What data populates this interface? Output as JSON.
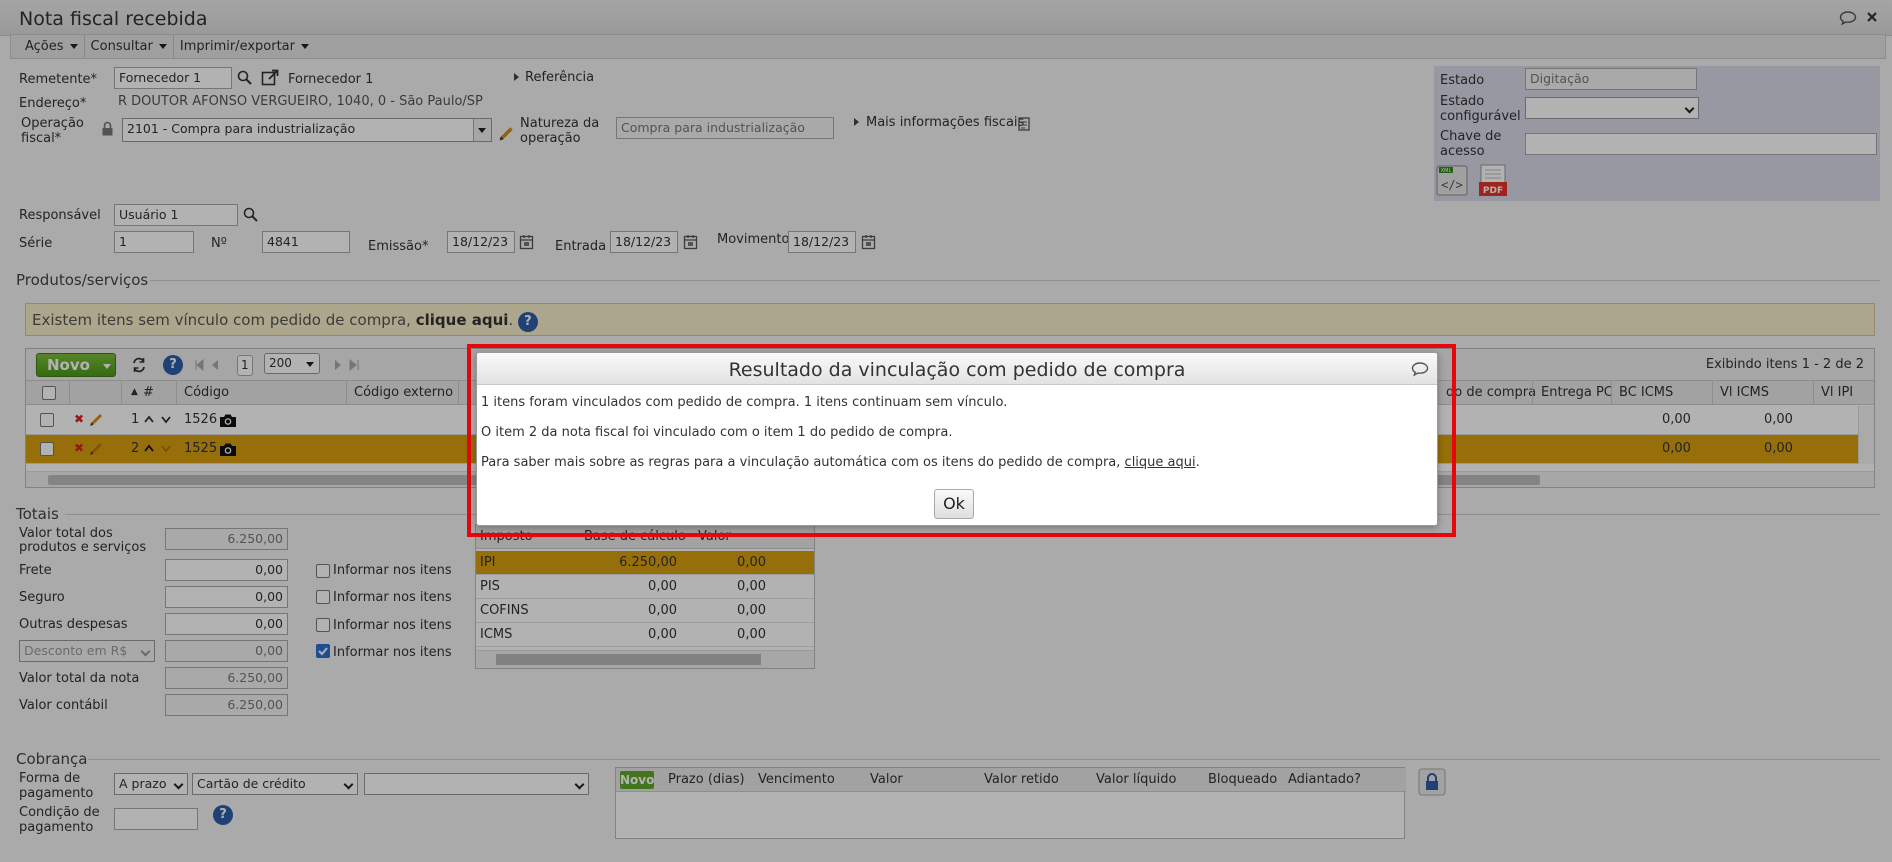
{
  "window": {
    "title": "Nota fiscal recebida"
  },
  "menubar": {
    "items": [
      "Ações",
      "Consultar",
      "Imprimir/exportar"
    ]
  },
  "header": {
    "remetente_label": "Remetente*",
    "remetente_value": "Fornecedor 1",
    "remetente_name": "Fornecedor 1",
    "referencia": "Referência",
    "endereco_label": "Endereço*",
    "endereco_value": "R DOUTOR AFONSO VERGUEIRO, 1040, 0 - São Paulo/SP",
    "operacao_label_1": "Operação",
    "operacao_label_2": "fiscal*",
    "operacao_value": "2101 - Compra para industrialização",
    "natureza_label_1": "Natureza da",
    "natureza_label_2": "operação",
    "natureza_value": "Compra para industrialização",
    "mais_info": "Mais informações fiscais",
    "responsavel_label": "Responsável",
    "responsavel_value": "Usuário 1",
    "serie_label": "Série",
    "serie_value": "1",
    "numero_label": "Nº",
    "numero_value": "4841",
    "emissao_label": "Emissão*",
    "emissao_value": "18/12/23",
    "entrada_label": "Entrada",
    "entrada_value": "18/12/23",
    "movimento_label": "Movimento",
    "movimento_value": "18/12/23"
  },
  "status_panel": {
    "estado_label": "Estado",
    "estado_value": "Digitação",
    "estado_conf_label_1": "Estado",
    "estado_conf_label_2": "configurável",
    "estado_conf_value": "",
    "chave_label_1": "Chave de",
    "chave_label_2": "acesso",
    "chave_value": "",
    "xml_label": "XML",
    "pdf_label": "PDF"
  },
  "produtos": {
    "section_title": "Produtos/serviços",
    "notice_text": "Existem itens sem vínculo com pedido de compra,",
    "notice_link": "clique aqui",
    "novo_label": "Novo",
    "page": "1",
    "page_size": "200",
    "exibindo": "Exibindo itens 1 - 2 de 2",
    "columns": [
      "#",
      "Código",
      "Código externo",
      "do de compra",
      "Entrega PC",
      "BC ICMS",
      "Vl ICMS",
      "Vl IPI"
    ],
    "rows": [
      {
        "num": "1",
        "codigo": "1526",
        "bc_icms": "0,00",
        "vl_icms": "0,00"
      },
      {
        "num": "2",
        "codigo": "1525",
        "bc_icms": "0,00",
        "vl_icms": "0,00"
      }
    ]
  },
  "totais": {
    "section_title": "Totais",
    "valor_total_label_1": "Valor total dos",
    "valor_total_label_2": "produtos e serviços",
    "valor_total_value": "6.250,00",
    "frete_label": "Frete",
    "frete_value": "0,00",
    "seguro_label": "Seguro",
    "seguro_value": "0,00",
    "outras_label": "Outras despesas",
    "outras_value": "0,00",
    "desconto_select": "Desconto em R$",
    "desconto_value": "0,00",
    "valor_nota_label": "Valor total da nota",
    "valor_nota_value": "6.250,00",
    "valor_contabil_label": "Valor contábil",
    "valor_contabil_value": "6.250,00",
    "informar_label": "Informar nos itens",
    "informar_checked": [
      false,
      false,
      false,
      true
    ]
  },
  "impostos": {
    "columns": [
      "Imposto",
      "Base de cálculo",
      "Valor"
    ],
    "rows": [
      {
        "imposto": "IPI",
        "base": "6.250,00",
        "valor": "0,00"
      },
      {
        "imposto": "PIS",
        "base": "0,00",
        "valor": "0,00"
      },
      {
        "imposto": "COFINS",
        "base": "0,00",
        "valor": "0,00"
      },
      {
        "imposto": "ICMS",
        "base": "0,00",
        "valor": "0,00"
      }
    ]
  },
  "cobranca": {
    "section_title": "Cobrança",
    "forma_label_1": "Forma de",
    "forma_label_2": "pagamento",
    "forma_value": "A prazo",
    "meio_value": "Cartão de crédito",
    "extra_value": "",
    "condicao_label_1": "Condição de",
    "condicao_label_2": "pagamento",
    "condicao_value": "",
    "novo_label": "Novo",
    "columns": [
      "Prazo (dias)",
      "Vencimento",
      "Valor",
      "Valor retido",
      "Valor líquido",
      "Bloqueado",
      "Adiantado?"
    ]
  },
  "dialog": {
    "title": "Resultado da vinculação com pedido de compra",
    "line1": "1 itens foram vinculados com pedido de compra. 1 itens continuam sem vínculo.",
    "line2": "O item 2 da nota fiscal foi vinculado com o item 1 do pedido de compra.",
    "line3": "Para saber mais sobre as regras para a vinculação automática com os itens do pedido de compra,",
    "line3_link": "clique aqui",
    "ok_label": "Ok"
  },
  "colors": {
    "accent_green": "#5fa82a",
    "selected_row": "#d9a00f",
    "highlight_frame": "#e8060d",
    "link_blue": "#2f5ea8"
  }
}
